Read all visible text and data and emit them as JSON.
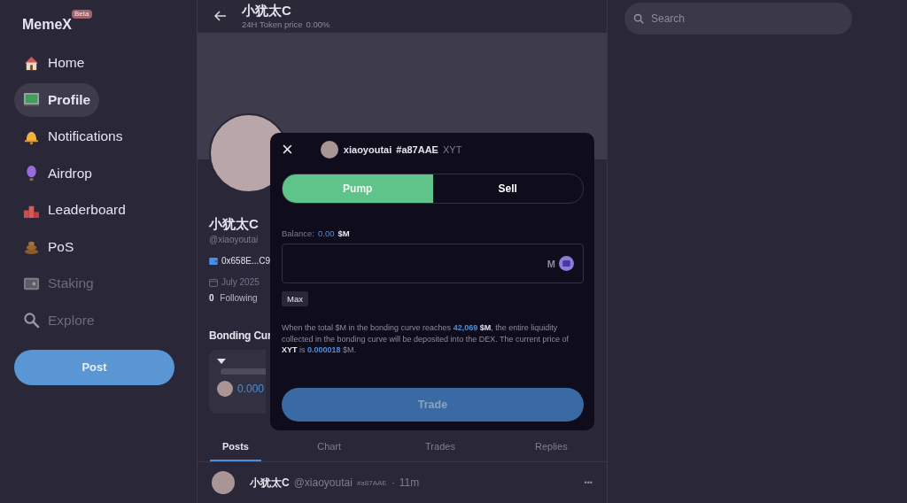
{
  "sidebar": {
    "logo": "MemeX",
    "logo_badge": "Beta",
    "items": [
      {
        "label": "Home",
        "selected": false,
        "disabled": false
      },
      {
        "label": "Profile",
        "selected": true,
        "disabled": false
      },
      {
        "label": "Notifications",
        "selected": false,
        "disabled": false
      },
      {
        "label": "Airdrop",
        "selected": false,
        "disabled": false
      },
      {
        "label": "Leaderboard",
        "selected": false,
        "disabled": false
      },
      {
        "label": "PoS",
        "selected": false,
        "disabled": false
      },
      {
        "label": "Staking",
        "selected": false,
        "disabled": true
      },
      {
        "label": "Explore",
        "selected": false,
        "disabled": true
      }
    ],
    "post_button": "Post"
  },
  "header": {
    "title": "小犹太C",
    "subtitle_label": "24H Token price",
    "subtitle_value": "0.00%"
  },
  "profile": {
    "name": "小犹太C",
    "handle": "@xiaoyoutai",
    "wallet": "0x658E...C9",
    "joined": "July 2025",
    "following_count": "0",
    "following_label": "Following",
    "bonding_heading": "Bonding Cur",
    "bonding_value": "0.000"
  },
  "tabs": [
    {
      "label": "Posts",
      "selected": true
    },
    {
      "label": "Chart",
      "selected": false
    },
    {
      "label": "Trades",
      "selected": false
    },
    {
      "label": "Replies",
      "selected": false
    }
  ],
  "post": {
    "name": "小犹太C",
    "handle": "@xiaoyoutai",
    "tag": "#a87AAE",
    "separator": "·",
    "time": "11m",
    "menu": "•••"
  },
  "search": {
    "placeholder": "Search"
  },
  "modal": {
    "close": "×",
    "username": "xiaoyoutai",
    "user_tag": "#a87AAE",
    "ticker": "XYT",
    "modes": [
      {
        "label": "Pump",
        "selected": true
      },
      {
        "label": "Sell",
        "selected": false
      }
    ],
    "balance_label": "Balance:",
    "balance_value": "0.00",
    "balance_unit": "$M",
    "amount_unit": "M",
    "max_button": "Max",
    "notice": [
      {
        "kind": "plain",
        "text": "When the total $M in the bonding curve reaches "
      },
      {
        "kind": "value",
        "text": "42,069 "
      },
      {
        "kind": "unit",
        "text": "$M"
      },
      {
        "kind": "plain",
        "text": ", the entire liquidity collected in the bonding curve will be deposited into the DEX. The current price of "
      },
      {
        "kind": "unit",
        "text": "XYT"
      },
      {
        "kind": "plain",
        "text": " is "
      },
      {
        "kind": "value",
        "text": "0.000018"
      },
      {
        "kind": "plain",
        "text": " $M."
      }
    ],
    "trade_button": "Trade"
  }
}
